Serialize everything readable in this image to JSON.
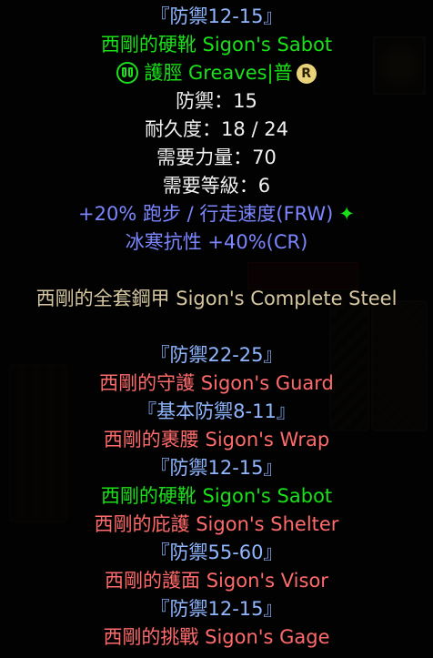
{
  "item": {
    "defense_range": "『防禦12-15』",
    "name": "西剛的硬靴 Sigon's Sabot",
    "base_type": "護脛 Greaves|普",
    "base_icon": "greaves-icon",
    "tier_badge": "R",
    "defense": "防禦：15",
    "durability": "耐久度：18 / 24",
    "req_str": "需要力量：70",
    "req_level": "需要等級：6",
    "magic_props": [
      "+20% 跑步 / 行走速度(FRW)",
      "冰寒抗性 +40%(CR)"
    ],
    "frw_mark": "✦"
  },
  "set": {
    "name": "西剛的全套鋼甲 Sigon's Complete Steel",
    "pieces": [
      {
        "range": "『防禦22-25』",
        "name": "西剛的守護 Sigon's Guard",
        "equipped": false
      },
      {
        "range": "『基本防禦8-11』",
        "name": "西剛的裹腰 Sigon's Wrap",
        "equipped": false
      },
      {
        "range": "『防禦12-15』",
        "name": "西剛的硬靴 Sigon's Sabot",
        "equipped": true
      },
      {
        "range": null,
        "name": "西剛的庇護 Sigon's Shelter",
        "equipped": false
      },
      {
        "range": "『防禦55-60』",
        "name": "西剛的護面 Sigon's Visor",
        "equipped": false
      },
      {
        "range": "『防禦12-15』",
        "name": "西剛的挑戰 Sigon's Gage",
        "equipped": false
      }
    ]
  },
  "colors": {
    "range": "#8fb6ff",
    "set_item": "#19e019",
    "white": "#f0f0f0",
    "magic": "#7b86ff",
    "missing": "#ff6a6a",
    "set_name": "#d6c7a0"
  }
}
